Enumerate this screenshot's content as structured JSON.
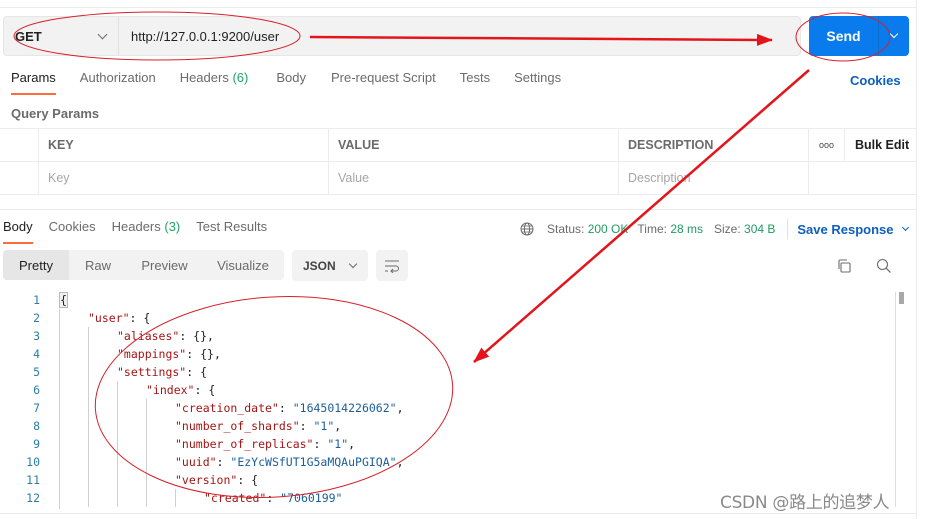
{
  "request": {
    "method": "GET",
    "url": "http://127.0.0.1:9200/user",
    "send_label": "Send"
  },
  "request_tabs": [
    {
      "label": "Params",
      "active": true
    },
    {
      "label": "Authorization"
    },
    {
      "label": "Headers",
      "count": "(6)"
    },
    {
      "label": "Body"
    },
    {
      "label": "Pre-request Script"
    },
    {
      "label": "Tests"
    },
    {
      "label": "Settings"
    }
  ],
  "cookies_link": "Cookies",
  "query_params": {
    "title": "Query Params",
    "headers": [
      "KEY",
      "VALUE",
      "DESCRIPTION"
    ],
    "more_label": "ooo",
    "bulk_edit": "Bulk Edit",
    "placeholders": [
      "Key",
      "Value",
      "Description"
    ]
  },
  "response_tabs": [
    {
      "label": "Body",
      "active": true
    },
    {
      "label": "Cookies"
    },
    {
      "label": "Headers",
      "count": "(3)"
    },
    {
      "label": "Test Results"
    }
  ],
  "response_status": {
    "status_label": "Status:",
    "status_value": "200 OK",
    "time_label": "Time:",
    "time_value": "28 ms",
    "size_label": "Size:",
    "size_value": "304 B",
    "save_response": "Save Response"
  },
  "view_modes": [
    "Pretty",
    "Raw",
    "Preview",
    "Visualize"
  ],
  "format": "JSON",
  "code_lines": [
    {
      "n": "1",
      "indent": 0,
      "parts": [
        [
          "p",
          "{"
        ]
      ]
    },
    {
      "n": "2",
      "indent": 1,
      "parts": [
        [
          "k",
          "\"user\""
        ],
        [
          "p",
          ": {"
        ]
      ]
    },
    {
      "n": "3",
      "indent": 2,
      "parts": [
        [
          "k",
          "\"aliases\""
        ],
        [
          "p",
          ": {},"
        ]
      ]
    },
    {
      "n": "4",
      "indent": 2,
      "parts": [
        [
          "k",
          "\"mappings\""
        ],
        [
          "p",
          ": {},"
        ]
      ]
    },
    {
      "n": "5",
      "indent": 2,
      "parts": [
        [
          "k",
          "\"settings\""
        ],
        [
          "p",
          ": {"
        ]
      ]
    },
    {
      "n": "6",
      "indent": 3,
      "parts": [
        [
          "k",
          "\"index\""
        ],
        [
          "p",
          ": {"
        ]
      ]
    },
    {
      "n": "7",
      "indent": 4,
      "parts": [
        [
          "k",
          "\"creation_date\""
        ],
        [
          "p",
          ": "
        ],
        [
          "s",
          "\"1645014226062\""
        ],
        [
          "p",
          ","
        ]
      ]
    },
    {
      "n": "8",
      "indent": 4,
      "parts": [
        [
          "k",
          "\"number_of_shards\""
        ],
        [
          "p",
          ": "
        ],
        [
          "s",
          "\"1\""
        ],
        [
          "p",
          ","
        ]
      ]
    },
    {
      "n": "9",
      "indent": 4,
      "parts": [
        [
          "k",
          "\"number_of_replicas\""
        ],
        [
          "p",
          ": "
        ],
        [
          "s",
          "\"1\""
        ],
        [
          "p",
          ","
        ]
      ]
    },
    {
      "n": "10",
      "indent": 4,
      "parts": [
        [
          "k",
          "\"uuid\""
        ],
        [
          "p",
          ": "
        ],
        [
          "s",
          "\"EzYcWSfUT1G5aMQAuPGIQA\""
        ],
        [
          "p",
          ","
        ]
      ]
    },
    {
      "n": "11",
      "indent": 4,
      "parts": [
        [
          "k",
          "\"version\""
        ],
        [
          "p",
          ": {"
        ]
      ]
    },
    {
      "n": "12",
      "indent": 5,
      "parts": [
        [
          "k",
          "\"created\""
        ],
        [
          "p",
          ": "
        ],
        [
          "s",
          "\"7060199\""
        ]
      ]
    }
  ],
  "watermark": "CSDN @路上的追梦人",
  "colors": {
    "accent_orange": "#ff6c37",
    "send_blue": "#097bed",
    "link_blue": "#0b5fbf",
    "status_green": "#1f9b63",
    "annotation_red": "#e3151a"
  }
}
